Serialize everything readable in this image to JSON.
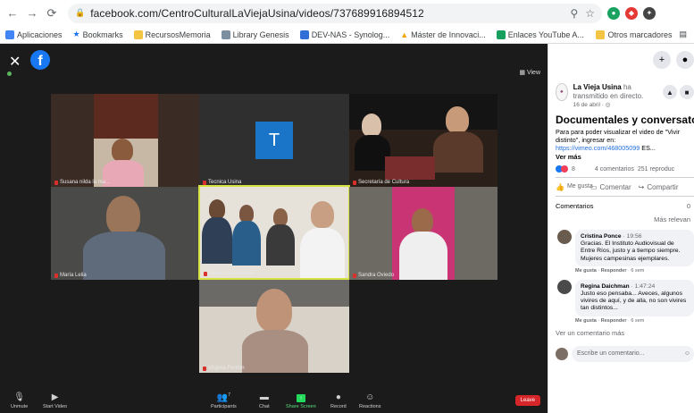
{
  "browser": {
    "url": "facebook.com/CentroCulturalLaViejaUsina/videos/737689916894512",
    "bookmarks": [
      "Aplicaciones",
      "Bookmarks",
      "RecursosMemoria",
      "Library Genesis",
      "DEV-NAS - Synolog...",
      "Máster de Innovaci...",
      "Enlaces YouTube A..."
    ],
    "other_bookmarks": "Otros marcadores"
  },
  "video": {
    "view_label": "View",
    "participants": [
      {
        "name": "Susana nilda la ma..."
      },
      {
        "name": "Tecnica Usina",
        "initial": "T"
      },
      {
        "name": "Secretaría de Cultura"
      },
      {
        "name": "María Lelia"
      },
      {
        "name": "Tania Sciomachen"
      },
      {
        "name": "Sandra Oviedo"
      },
      {
        "name": "Virginia Fermín"
      }
    ],
    "toolbar": {
      "unmute": "Unmute",
      "start_video": "Start Video",
      "participants": "Participants",
      "participants_count": "7",
      "chat": "Chat",
      "share_screen": "Share Screen",
      "record": "Record",
      "reactions": "Reactions",
      "leave": "Leave"
    }
  },
  "panel": {
    "page_name": "La Vieja Usina",
    "page_action": "ha transmitido en directo.",
    "date": "16 de abril ·",
    "title": "Documentales y conversatorio",
    "description": "Para para poder visualizar el video de \"Vivir distinto\", ingresar en:",
    "link": "https://vimeo.com/468005099",
    "link_suffix": " ES...",
    "see_more": "Ver más",
    "reactions_count": "8",
    "comments_count": "4 comentarios",
    "views": "251 reproduc",
    "like": "Me gusta",
    "comment": "Comentar",
    "share": "Compartir",
    "comments_header": "Comentarios",
    "comments_header_count": "0",
    "sort": "Más relevan",
    "comments": [
      {
        "author": "Cristina Ponce",
        "time": "· 19:56",
        "text": "Gracias. El Instituto Audiovisual de Entre Ríos, justo y a tiempo siempre. Mujeres campesinas ejemplares.",
        "like": "Me gusta",
        "reply": "Responder",
        "age": "· 6 sem"
      },
      {
        "author": "Regina Daichman",
        "time": "· 1:47:24",
        "text": "Justo eso pensaba... Aveces, algunos vivires de aquí, y de alla, no son vivires tan distintos...",
        "like": "Me gusta",
        "reply": "Responder",
        "age": "· 6 sem"
      }
    ],
    "more_comments": "Ver un comentario más",
    "write_placeholder": "Escribe un comentario..."
  }
}
